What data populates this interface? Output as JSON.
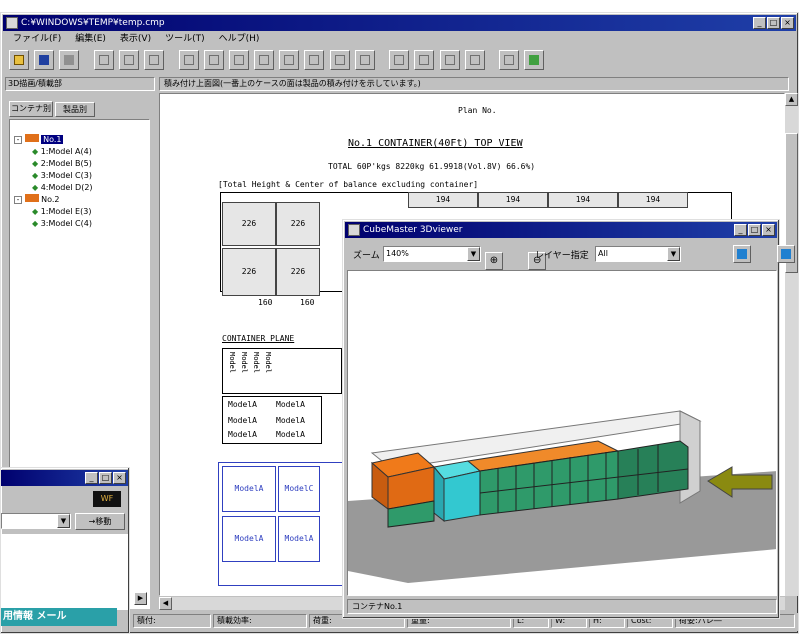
{
  "main_window": {
    "title": "C:¥WINDOWS¥TEMP¥temp.cmp",
    "menu": [
      "ファイル(F)",
      "編集(E)",
      "表示(V)",
      "ツール(T)",
      "ヘルプ(H)"
    ],
    "left_panel_header": "3D描画/積載部",
    "info_bar_text": "積み付け上面図(一番上のケースの面は製品の積み付けを示しています。)",
    "tabs": [
      "コンテナ別",
      "製品別"
    ],
    "tree": {
      "containers": [
        {
          "label": "No.1",
          "items": [
            "1:Model A(4)",
            "2:Model B(5)",
            "3:Model C(3)",
            "4:Model D(2)"
          ]
        },
        {
          "label": "No.2",
          "items": [
            "1:Model E(3)",
            "3:Model C(4)"
          ]
        }
      ]
    },
    "status_bar": [
      "積付:",
      "積載効率:",
      "荷重:",
      "重量:",
      "L:",
      "W:",
      "H:",
      "Cost:",
      "荷姿:パレ―"
    ]
  },
  "drawing": {
    "plan_no": "Plan No.",
    "title": "No.1 CONTAINER(40Ft) TOP VIEW",
    "total_line": "TOTAL  60P'kgs  8220kg  61.9918(Vol.8V) 66.6%)",
    "subtitle": "[Total Height & Center of balance excluding container]",
    "top_row": [
      "194",
      "194",
      "194",
      "194"
    ],
    "grid_cells": [
      "226",
      "226",
      "226",
      "226"
    ],
    "dim_labels": [
      "160",
      "160"
    ],
    "plane_label": "CONTAINER PLANE",
    "side_labels": [
      "Model",
      "Model",
      "Model",
      "Model"
    ],
    "bottom_labels": [
      "ModelA",
      "ModelC",
      "ModelA",
      "ModelA"
    ]
  },
  "viewer": {
    "title": "CubeMaster 3Dviewer",
    "zoom_label": "ズーム",
    "zoom_value": "140%",
    "layer_label": "レイヤー指定",
    "layer_value": "All",
    "status": "コンテナNo.1"
  },
  "bottom_left_window": {
    "move_button": "移動",
    "banner_text": "用情報 メール"
  },
  "colors": {
    "title_bar": "#00006e",
    "orange_box": "#f07a1a",
    "cyan_box": "#33c8d0",
    "green_box": "#2f9a6a",
    "arrow": "#8a8a10"
  }
}
